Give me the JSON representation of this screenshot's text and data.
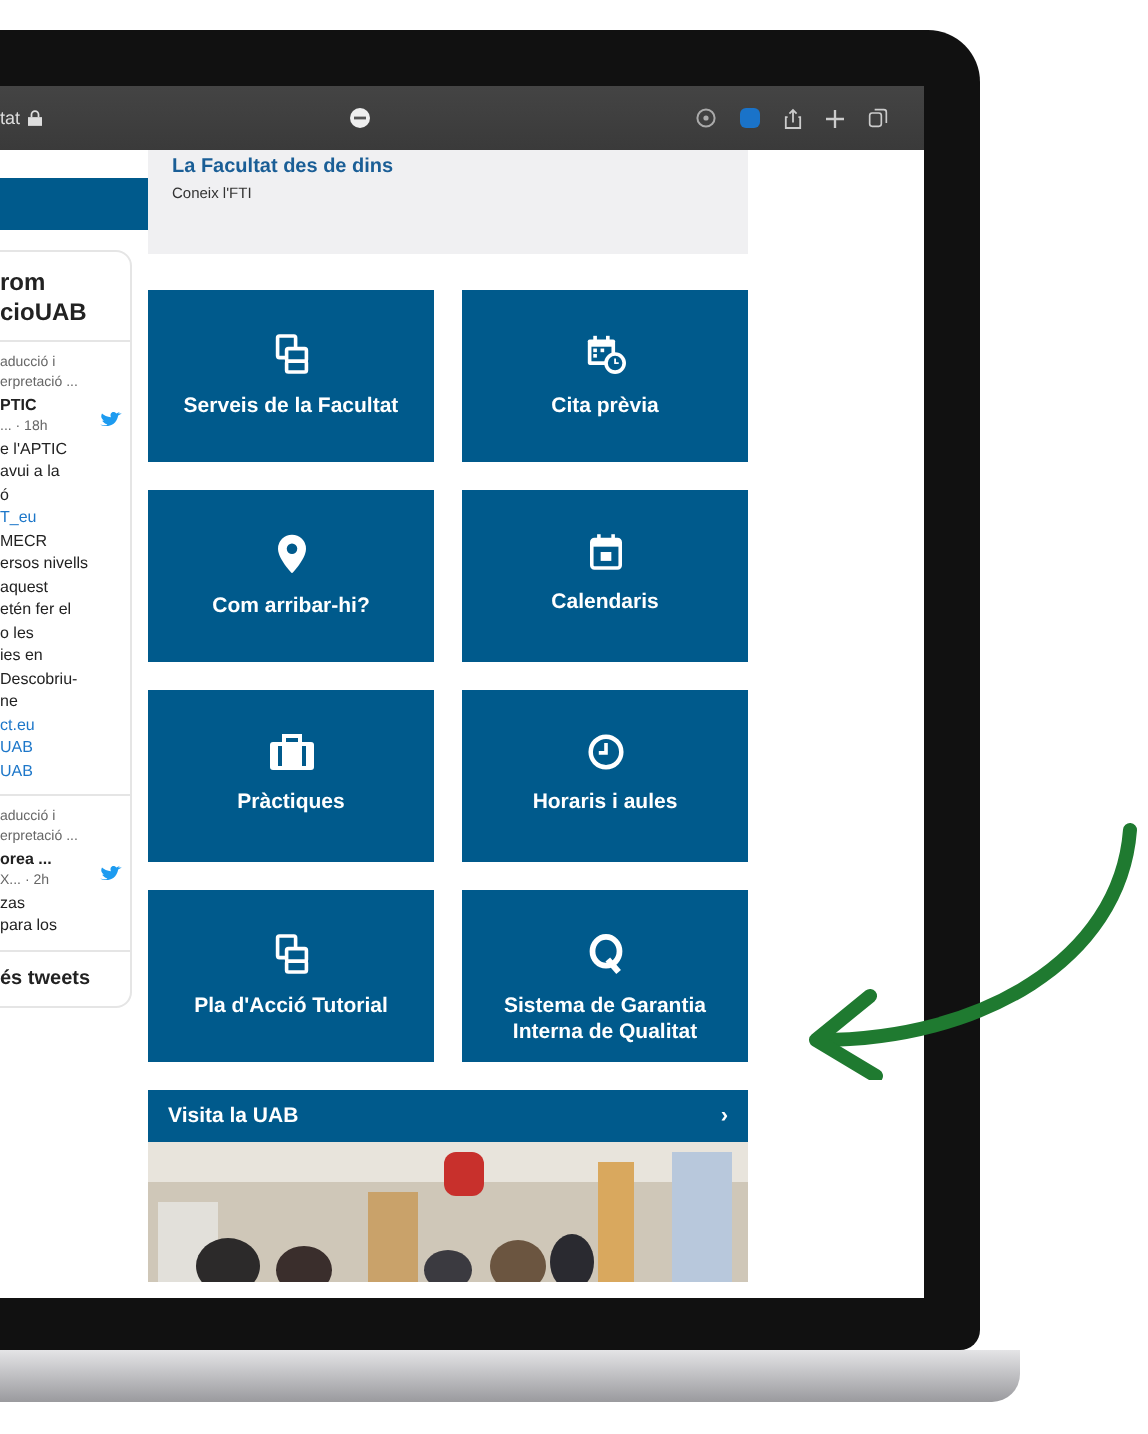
{
  "browser": {
    "address": "tat"
  },
  "sidebar": {
    "title_lines": [
      "rom",
      "cioUAB"
    ],
    "tweets": [
      {
        "lines": [
          {
            "kind": "meta",
            "text": "aducció i"
          },
          {
            "kind": "meta",
            "text": "erpretació ..."
          },
          {
            "kind": "author",
            "text": "PTIC"
          },
          {
            "kind": "meta",
            "text": "... · 18h"
          },
          {
            "kind": "text",
            "text": "e l'APTIC"
          },
          {
            "kind": "text",
            "text": "avui a la"
          },
          {
            "kind": "text",
            "text": "ó"
          },
          {
            "kind": "link",
            "text": "T_eu"
          },
          {
            "kind": "text",
            "text": "MECR"
          },
          {
            "kind": "text",
            "text": "ersos nivells"
          },
          {
            "kind": "text",
            "text": "aquest"
          },
          {
            "kind": "text",
            "text": "etén fer el"
          },
          {
            "kind": "text",
            "text": "o les"
          },
          {
            "kind": "text",
            "text": "ies en"
          },
          {
            "kind": "text",
            "text": "Descobriu-ne"
          },
          {
            "kind": "link",
            "text": "ct.eu"
          },
          {
            "kind": "link",
            "text": "UAB"
          },
          {
            "kind": "link",
            "text": "UAB"
          }
        ]
      },
      {
        "lines": [
          {
            "kind": "meta",
            "text": "aducció i"
          },
          {
            "kind": "meta",
            "text": "erpretació ..."
          },
          {
            "kind": "author",
            "text": "orea ..."
          },
          {
            "kind": "meta",
            "text": "X... · 2h"
          },
          {
            "kind": "text",
            "text": "zas"
          },
          {
            "kind": "text",
            "text": "para los"
          }
        ]
      }
    ],
    "footer": "és tweets"
  },
  "card": {
    "title": "La Facultat des de dins",
    "subtitle": "Coneix l'FTI"
  },
  "tiles": [
    {
      "kind": "documents",
      "label": "Serveis de la Facultat"
    },
    {
      "kind": "calendar-clock",
      "label": "Cita prèvia"
    },
    {
      "kind": "pin",
      "label": "Com arribar-hi?"
    },
    {
      "kind": "calendar",
      "label": "Calendaris"
    },
    {
      "kind": "briefcase",
      "label": "Pràctiques"
    },
    {
      "kind": "clock",
      "label": "Horaris i aules"
    },
    {
      "kind": "documents",
      "label": "Pla d'Acció Tutorial"
    },
    {
      "kind": "letter",
      "label": "Sistema de Garantia Interna de Qualitat"
    }
  ],
  "banner": {
    "label": "Visita la UAB",
    "chevron": "›"
  }
}
